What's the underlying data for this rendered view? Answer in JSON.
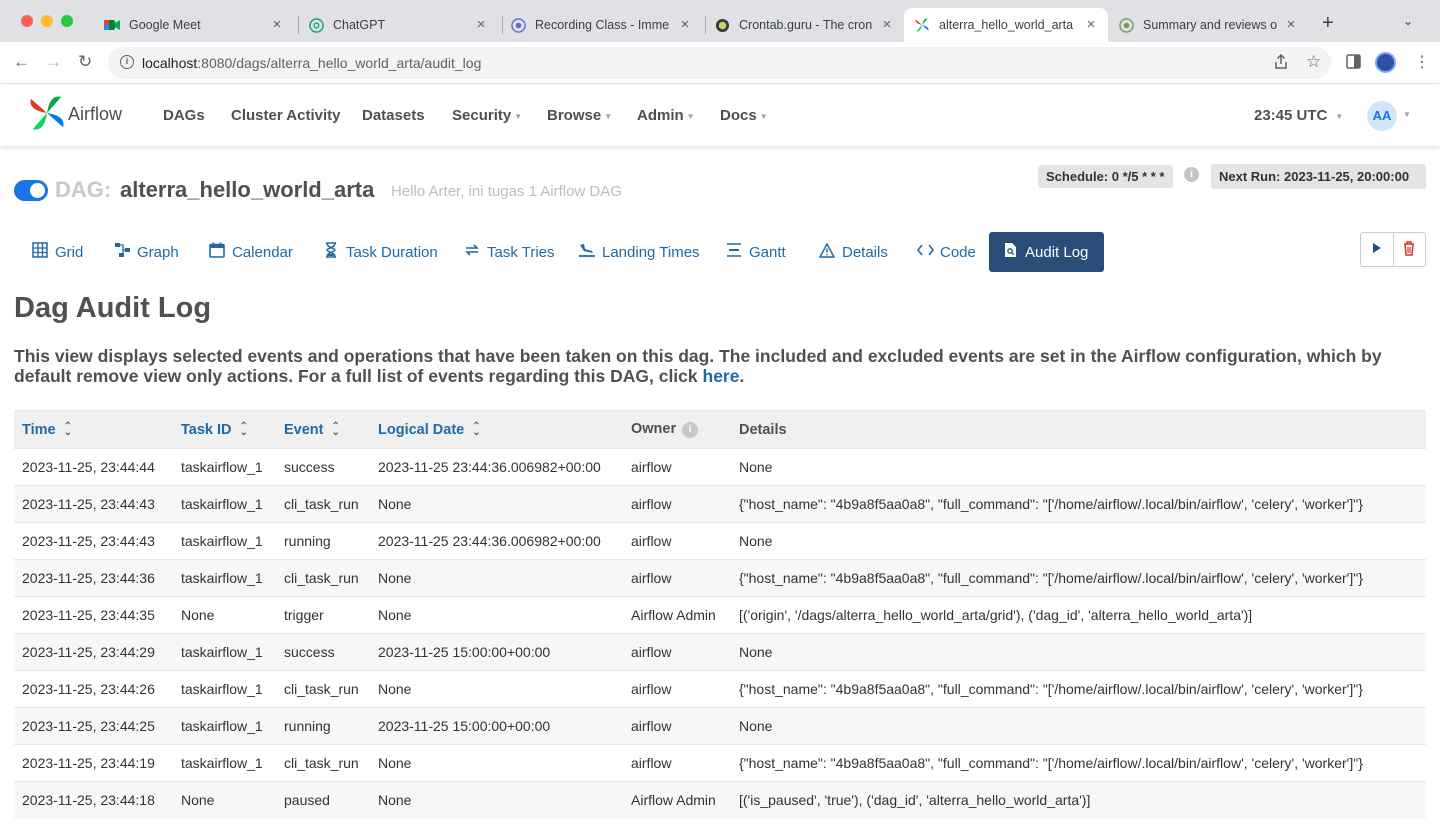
{
  "browser": {
    "tabs": [
      {
        "title": "Google Meet",
        "icon": "google-meet-icon"
      },
      {
        "title": "ChatGPT",
        "icon": "chatgpt-icon"
      },
      {
        "title": "Recording Class - Imme",
        "icon": "recording-icon"
      },
      {
        "title": "Crontab.guru - The cron",
        "icon": "crontab-icon"
      },
      {
        "title": "alterra_hello_world_arta",
        "icon": "airflow-icon",
        "active": true
      },
      {
        "title": "Summary and reviews o",
        "icon": "reviews-icon"
      }
    ],
    "url_host": "localhost",
    "url_rest": ":8080/dags/alterra_hello_world_arta/audit_log"
  },
  "navbar": {
    "brand": "Airflow",
    "items": [
      {
        "label": "DAGs",
        "dropdown": false
      },
      {
        "label": "Cluster Activity",
        "dropdown": false
      },
      {
        "label": "Datasets",
        "dropdown": false
      },
      {
        "label": "Security",
        "dropdown": true
      },
      {
        "label": "Browse",
        "dropdown": true
      },
      {
        "label": "Admin",
        "dropdown": true
      },
      {
        "label": "Docs",
        "dropdown": true
      }
    ],
    "clock": "23:45 UTC",
    "avatar_initials": "AA"
  },
  "dag": {
    "label": "DAG:",
    "id": "alterra_hello_world_arta",
    "description": "Hello Arter, ini tugas 1 Airflow DAG",
    "paused": false,
    "schedule": "Schedule: 0 */5 * * *",
    "next_run": "Next Run: 2023-11-25, 20:00:00"
  },
  "view_tabs": [
    {
      "label": "Grid",
      "icon": "grid-icon"
    },
    {
      "label": "Graph",
      "icon": "graph-icon"
    },
    {
      "label": "Calendar",
      "icon": "calendar-icon"
    },
    {
      "label": "Task Duration",
      "icon": "hourglass-icon"
    },
    {
      "label": "Task Tries",
      "icon": "retry-icon"
    },
    {
      "label": "Landing Times",
      "icon": "landing-icon"
    },
    {
      "label": "Gantt",
      "icon": "gantt-icon"
    },
    {
      "label": "Details",
      "icon": "warning-triangle-icon"
    },
    {
      "label": "Code",
      "icon": "code-icon"
    },
    {
      "label": "Audit Log",
      "icon": "audit-file-icon",
      "active": true
    }
  ],
  "page": {
    "title": "Dag Audit Log",
    "intro": "This view displays selected events and operations that have been taken on this dag. The included and excluded events are set in the Airflow configuration, which by default remove view only actions. For a full list of events regarding this DAG, click ",
    "intro_link": "here",
    "intro_end": "."
  },
  "table": {
    "columns": [
      "Time",
      "Task ID",
      "Event",
      "Logical Date",
      "Owner",
      "Details"
    ],
    "rows": [
      [
        "2023-11-25, 23:44:44",
        "taskairflow_1",
        "success",
        "2023-11-25 23:44:36.006982+00:00",
        "airflow",
        "None"
      ],
      [
        "2023-11-25, 23:44:43",
        "taskairflow_1",
        "cli_task_run",
        "None",
        "airflow",
        "{\"host_name\": \"4b9a8f5aa0a8\", \"full_command\": \"['/home/airflow/.local/bin/airflow', 'celery', 'worker']\"}"
      ],
      [
        "2023-11-25, 23:44:43",
        "taskairflow_1",
        "running",
        "2023-11-25 23:44:36.006982+00:00",
        "airflow",
        "None"
      ],
      [
        "2023-11-25, 23:44:36",
        "taskairflow_1",
        "cli_task_run",
        "None",
        "airflow",
        "{\"host_name\": \"4b9a8f5aa0a8\", \"full_command\": \"['/home/airflow/.local/bin/airflow', 'celery', 'worker']\"}"
      ],
      [
        "2023-11-25, 23:44:35",
        "None",
        "trigger",
        "None",
        "Airflow Admin",
        "[('origin', '/dags/alterra_hello_world_arta/grid'), ('dag_id', 'alterra_hello_world_arta')]"
      ],
      [
        "2023-11-25, 23:44:29",
        "taskairflow_1",
        "success",
        "2023-11-25 15:00:00+00:00",
        "airflow",
        "None"
      ],
      [
        "2023-11-25, 23:44:26",
        "taskairflow_1",
        "cli_task_run",
        "None",
        "airflow",
        "{\"host_name\": \"4b9a8f5aa0a8\", \"full_command\": \"['/home/airflow/.local/bin/airflow', 'celery', 'worker']\"}"
      ],
      [
        "2023-11-25, 23:44:25",
        "taskairflow_1",
        "running",
        "2023-11-25 15:00:00+00:00",
        "airflow",
        "None"
      ],
      [
        "2023-11-25, 23:44:19",
        "taskairflow_1",
        "cli_task_run",
        "None",
        "airflow",
        "{\"host_name\": \"4b9a8f5aa0a8\", \"full_command\": \"['/home/airflow/.local/bin/airflow', 'celery', 'worker']\"}"
      ],
      [
        "2023-11-25, 23:44:18",
        "None",
        "paused",
        "None",
        "Airflow Admin",
        "[('is_paused', 'true'), ('dag_id', 'alterra_hello_world_arta')]"
      ]
    ]
  }
}
